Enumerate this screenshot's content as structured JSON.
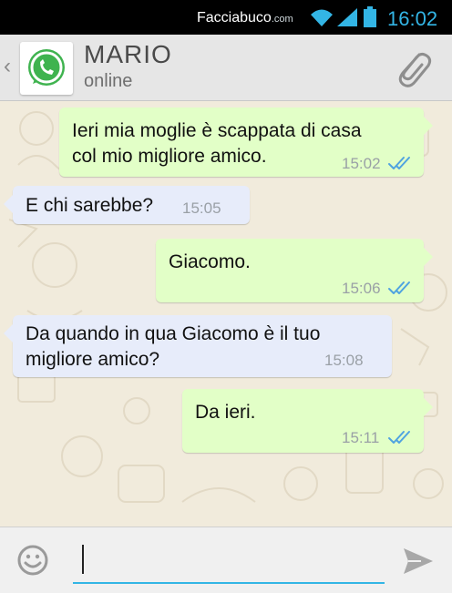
{
  "status_bar": {
    "brand": "Facciabuco",
    "brand_suffix": ".com",
    "time": "16:02",
    "icons": [
      "wifi-icon",
      "signal-icon",
      "battery-icon"
    ],
    "accent_color": "#33b5e5"
  },
  "header": {
    "contact_name": "MARIO",
    "contact_status": "online",
    "back_icon": "chevron-left-icon",
    "avatar_icon": "whatsapp-icon",
    "attach_icon": "paperclip-icon"
  },
  "messages": [
    {
      "direction": "out",
      "lines": [
        "Ieri mia moglie è scappata di casa",
        "col mio migliore amico."
      ],
      "time": "15:02",
      "read": true
    },
    {
      "direction": "in",
      "lines": [
        "E chi sarebbe?"
      ],
      "time": "15:05"
    },
    {
      "direction": "out",
      "lines": [
        "Giacomo."
      ],
      "time": "15:06",
      "read": true
    },
    {
      "direction": "in",
      "lines": [
        "Da quando in qua Giacomo è il tuo",
        "migliore amico?"
      ],
      "time": "15:08"
    },
    {
      "direction": "out",
      "lines": [
        "Da ieri."
      ],
      "time": "15:11",
      "read": true
    }
  ],
  "input_bar": {
    "emoji_icon": "smiley-icon",
    "message_value": "",
    "send_icon": "send-icon"
  },
  "colors": {
    "outgoing_bubble": "#e2ffc7",
    "incoming_bubble": "#e7ecfa",
    "read_ticks": "#4fa3e0",
    "chat_background": "#f1ebdc"
  }
}
